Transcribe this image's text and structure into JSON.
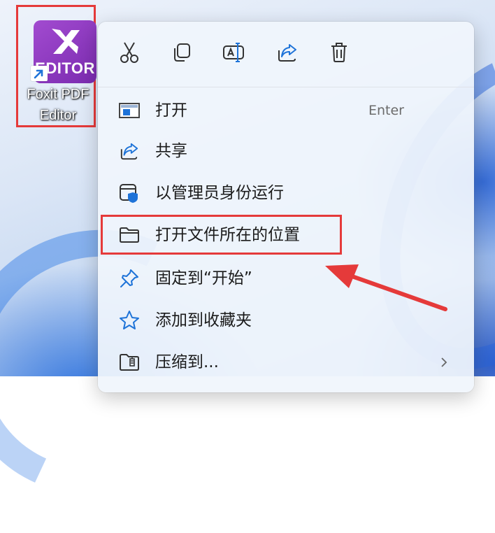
{
  "desktop_icon": {
    "name_line1": "Foxit PDF",
    "name_line2": "Editor",
    "tile_word": "EDITOR",
    "tile_color": "#8e3cc4",
    "icon": "foxit-editor-icon",
    "shortcut_icon": "shortcut-arrow-icon"
  },
  "context_menu": {
    "toolbar": [
      {
        "icon": "cut-icon"
      },
      {
        "icon": "copy-icon"
      },
      {
        "icon": "rename-icon"
      },
      {
        "icon": "share-icon"
      },
      {
        "icon": "delete-icon"
      }
    ],
    "items": [
      {
        "label": "打开",
        "accelerator": "Enter",
        "icon": "open-window-icon"
      },
      {
        "label": "共享",
        "icon": "share-icon"
      },
      {
        "label": "以管理员身份运行",
        "icon": "admin-shield-icon"
      },
      {
        "label": "打开文件所在的位置",
        "icon": "folder-icon"
      },
      {
        "label": "固定到“开始”",
        "icon": "pin-icon"
      },
      {
        "label": "添加到收藏夹",
        "icon": "star-icon"
      },
      {
        "label": "压缩到...",
        "icon": "zip-folder-icon",
        "submenu": true
      }
    ]
  },
  "annotation": {
    "highlight_color": "#e53a3a",
    "highlighted_item": "打开文件所在的位置"
  }
}
